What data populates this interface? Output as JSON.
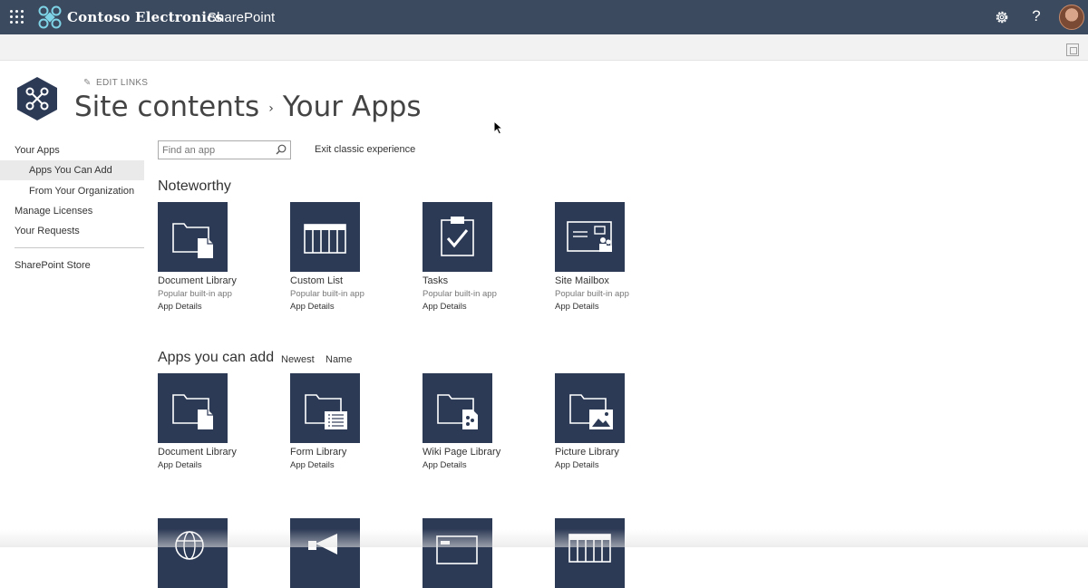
{
  "suite_bar": {
    "brand": "Contoso Electronics",
    "app_name": "SharePoint"
  },
  "site_header": {
    "edit_links": "EDIT LINKS",
    "breadcrumb_root": "Site contents",
    "breadcrumb_separator": "›",
    "breadcrumb_current": "Your Apps"
  },
  "left_nav": {
    "items": [
      {
        "label": "Your Apps",
        "selected": false
      },
      {
        "label": "Apps You Can Add",
        "selected": true
      },
      {
        "label": "From Your Organization",
        "selected": false
      },
      {
        "label": "Manage Licenses",
        "selected": false
      },
      {
        "label": "Your Requests",
        "selected": false
      },
      {
        "label": "SharePoint Store",
        "selected": false
      }
    ]
  },
  "search": {
    "placeholder": "Find an app",
    "value": ""
  },
  "exit_classic": "Exit classic experience",
  "noteworthy": {
    "title": "Noteworthy",
    "tiles": [
      {
        "name": "Document Library",
        "subtitle": "Popular built-in app",
        "details": "App Details",
        "icon": "document-library-icon"
      },
      {
        "name": "Custom List",
        "subtitle": "Popular built-in app",
        "details": "App Details",
        "icon": "custom-list-icon"
      },
      {
        "name": "Tasks",
        "subtitle": "Popular built-in app",
        "details": "App Details",
        "icon": "tasks-icon"
      },
      {
        "name": "Site Mailbox",
        "subtitle": "Popular built-in app",
        "details": "App Details",
        "icon": "site-mailbox-icon"
      }
    ]
  },
  "apps_you_can_add": {
    "title": "Apps you can add",
    "sort_options": [
      "Newest",
      "Name"
    ],
    "tiles": [
      {
        "name": "Document Library",
        "details": "App Details",
        "icon": "document-library-icon"
      },
      {
        "name": "Form Library",
        "details": "App Details",
        "icon": "form-library-icon"
      },
      {
        "name": "Wiki Page Library",
        "details": "App Details",
        "icon": "wiki-page-library-icon"
      },
      {
        "name": "Picture Library",
        "details": "App Details",
        "icon": "picture-library-icon"
      }
    ],
    "partial_tiles_icons": [
      "globe-icon",
      "announcement-icon",
      "contacts-icon",
      "list-icon"
    ]
  },
  "colors": {
    "suite_bar": "#3b4a5e",
    "tile_background": "#2d3a56",
    "nav_selected": "#eaeaea"
  }
}
